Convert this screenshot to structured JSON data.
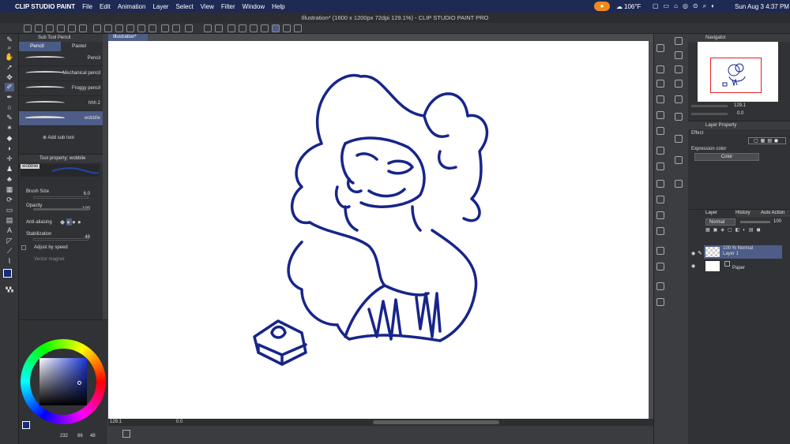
{
  "menubar": {
    "app_name": "CLIP STUDIO PAINT",
    "items": [
      "File",
      "Edit",
      "Animation",
      "Layer",
      "Select",
      "View",
      "Filter",
      "Window",
      "Help"
    ],
    "weather": "106°F",
    "datetime": "Sun Aug 3  4:37 PM"
  },
  "window": {
    "title": "Illustration* (1600 x 1200px 72dpi 129.1%) - CLIP STUDIO PAINT PRO"
  },
  "subtool": {
    "header": "Sub Tool Pencil",
    "tabs": [
      "Pencil",
      "Pastel"
    ],
    "brushes": [
      "Pencil",
      "Mechanical pencil",
      "Froggy pencil",
      "hhh 2",
      "wobblie"
    ],
    "add_label": "Add sub tool"
  },
  "toolprop": {
    "header": "Tool property: wobblie",
    "preview_name": "wobblie",
    "brush_size_label": "Brush Size",
    "brush_size_value": "6.0",
    "opacity_label": "Opacity",
    "opacity_value": "100",
    "antialias_label": "Anti-aliasing",
    "stabilization_label": "Stabilization",
    "stabilization_value": "48",
    "adjust_label": "Adjust by speed",
    "vector_label": "Vector magnet"
  },
  "color": {
    "main": "#1a2c7a",
    "sub": "#ffffff",
    "readout_h": "232",
    "readout_s": "86",
    "readout_v": "48"
  },
  "canvas": {
    "tab_label": "Illustration*",
    "stroke_color": "#17258a"
  },
  "status": {
    "zoom": "129.1",
    "angle": "0.0"
  },
  "navigator": {
    "title": "Navigator",
    "zoom": "129.1",
    "angle": "0.0"
  },
  "layerprop": {
    "title": "Layer Property",
    "effect_label": "Effect",
    "expr_label": "Expression color",
    "expr_value": "Color"
  },
  "layerpanel": {
    "tabs": [
      "Layer",
      "History",
      "Auto Action"
    ],
    "blend_mode": "Normal",
    "opacity": "100",
    "layers": [
      {
        "line1": "100 % Normal",
        "line2": "Layer 1"
      },
      {
        "line1": "",
        "line2": "Paper"
      }
    ]
  }
}
